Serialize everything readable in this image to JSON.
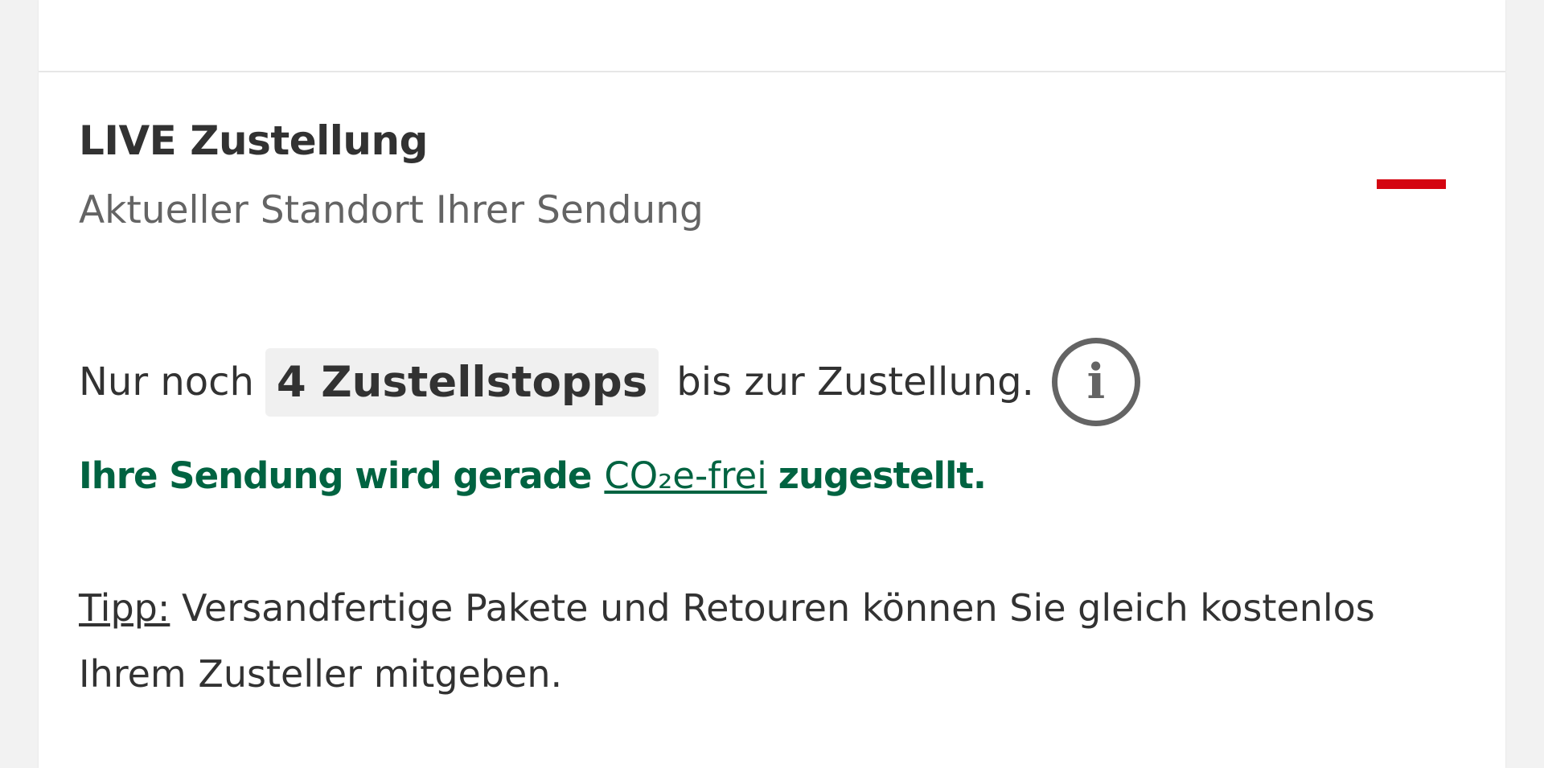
{
  "section": {
    "title": "LIVE Zustellung",
    "subtitle": "Aktueller Standort Ihrer Sendung",
    "collapse_icon": "minus-icon",
    "accent_color": "#d40511"
  },
  "delivery_status": {
    "prefix": "Nur noch",
    "stops_badge": "4 Zustellstopps",
    "suffix": "bis zur Zustellung.",
    "info_icon": "info-icon",
    "info_glyph": "i"
  },
  "co2_notice": {
    "prefix": "Ihre Sendung wird gerade",
    "link": "CO₂e-frei",
    "suffix": "zugestellt.",
    "color": "#006341"
  },
  "tip": {
    "label": "Tipp:",
    "text": " Versandfertige Pakete und Retouren können Sie gleich kostenlos Ihrem Zusteller mitgeben."
  }
}
